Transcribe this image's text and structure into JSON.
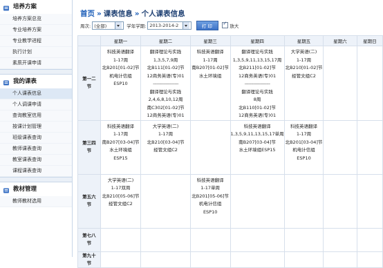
{
  "sidebar": {
    "sections": [
      {
        "title": "培养方案",
        "items": [
          "培养方案总览",
          "专业培养方案",
          "专业教学进程",
          "执行计划",
          "素质开课申请"
        ],
        "active": -1
      },
      {
        "title": "我的课表",
        "items": [
          "个人课表信息",
          "个人调课申请",
          "查询教室信用",
          "按课计划管理",
          "班级课表查询",
          "教师课表查询",
          "教室课表查询",
          "课程课表查询"
        ],
        "active": 0
      },
      {
        "title": "教材管理",
        "items": [
          "教师教材选用"
        ],
        "active": -1
      }
    ]
  },
  "breadcrumb": {
    "home": "首页",
    "sep1": "»",
    "level2": "课表信息",
    "sep2": "»",
    "level3": "个人课表信息"
  },
  "controls": {
    "week_label": "周次:",
    "week_value": "(全部)",
    "term_label": "学年学期:",
    "term_value": "2013-2014-2",
    "print_label": "打印",
    "zoom_label": "放大",
    "zoom_checked": true
  },
  "timetable": {
    "days": [
      "星期一",
      "星期二",
      "星期三",
      "星期四",
      "星期五",
      "星期六",
      "星期日"
    ],
    "rows": [
      {
        "label": [
          "第一二",
          "节"
        ],
        "cells": [
          [
            "科技英语翻译",
            "1-17周",
            "北B201[01-02]节",
            "机电计信组",
            "ESP10"
          ],
          [
            "翻译理论与实践",
            "1,3,5,7,9周",
            "北B111[01-02]节",
            "12商务英语(专)01",
            "--------------------",
            "翻译理论与实践",
            "2,4,6,8,10,12周",
            "南C302[01-02]节",
            "12商务英语(专)01"
          ],
          [
            "科技英语翻译",
            "1-17周",
            "南B207[01-02]节",
            "水土环境组"
          ],
          [
            "翻译理论与实践",
            "1,3,5,9,11,13,15,17周",
            "北B211[01-02]节",
            "12商务英语(专)01",
            "--------------------",
            "翻译理论与实践",
            "8周",
            "北B110[01-02]节",
            "12商务英语(专)01"
          ],
          [
            "大学英语(二)",
            "1-17周",
            "北B210[01-02]节",
            "经管文组C2"
          ],
          [],
          []
        ]
      },
      {
        "label": [
          "第三四",
          "节"
        ],
        "cells": [
          [
            "科技英语翻译",
            "1-17周",
            "南B207[03-04]节",
            "水土环境组",
            "ESP15"
          ],
          [
            "大学英语(二)",
            "1-17周",
            "北B210[03-04]节",
            "经管文组C2"
          ],
          [],
          [
            "科技英语翻译",
            "1,3,5,9,11,13,15,17单周",
            "南B207[03-04]节",
            "水土环境组ESP15"
          ],
          [
            "科技英语翻译",
            "1-17周",
            "北B201[03-04]节",
            "机电计信组",
            "ESP10"
          ],
          [],
          []
        ]
      },
      {
        "label": [
          "第五六",
          "节"
        ],
        "cells": [
          [
            "大学英语(二)",
            "1-17双周",
            "北B210[05-06]节",
            "经管文组C2"
          ],
          [],
          [
            "科技英语翻译",
            "1-17单周",
            "北B201[05-06]节",
            "机电计信组",
            "ESP10"
          ],
          [],
          [],
          [],
          []
        ]
      },
      {
        "label": [
          "第七八",
          "节"
        ],
        "cells": [
          [],
          [],
          [],
          [],
          [],
          [],
          []
        ]
      },
      {
        "label": [
          "第九十",
          "节"
        ],
        "cells": [
          [],
          [],
          [],
          [],
          [],
          [],
          []
        ]
      }
    ]
  }
}
